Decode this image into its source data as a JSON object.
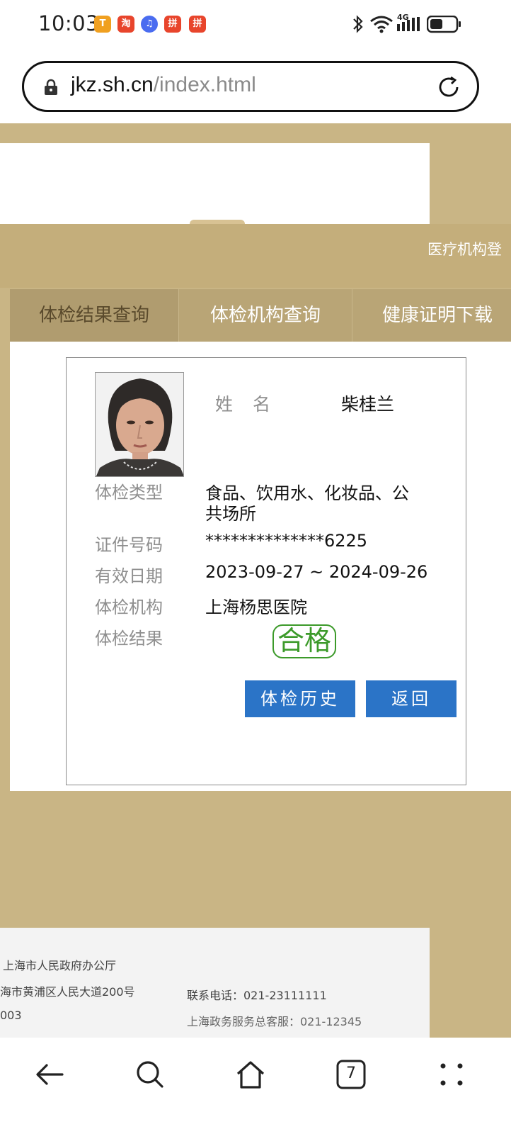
{
  "status_bar": {
    "time": "10:03",
    "apps": [
      {
        "icon": "message-app-icon",
        "color": "#f0a020",
        "glyph": "T"
      },
      {
        "icon": "taobao-app-icon",
        "color": "#e8452c",
        "glyph": "淘"
      },
      {
        "icon": "music-app-icon",
        "color": "#4a6cf0",
        "glyph": "♫"
      },
      {
        "icon": "pinduoduo-app-icon",
        "color": "#e8452c",
        "glyph": "拼"
      },
      {
        "icon": "pinduoduo-app-icon",
        "color": "#e8452c",
        "glyph": "拼"
      }
    ],
    "signal_label": "4G"
  },
  "browser": {
    "url_host": "jkz.sh.cn",
    "url_path": "/index.html"
  },
  "header": {
    "org_register": "医疗机构登"
  },
  "nav": {
    "items": [
      {
        "label": "体检结果查询"
      },
      {
        "label": "体检机构查询"
      },
      {
        "label": "健康证明下载"
      }
    ]
  },
  "record": {
    "name_label": "姓名",
    "name": "柴桂兰",
    "type_label": "体检类型",
    "type_line1": "食品、饮用水、化妆品、公",
    "type_line2": "共场所",
    "id_label": "证件号码",
    "id_value": "**************6225",
    "valid_label": "有效日期",
    "valid_value": "2023-09-27 ~ 2024-09-26",
    "org_label": "体检机构",
    "org_value": "上海杨思医院",
    "result_label": "体检结果",
    "result_value": "合格",
    "history_button": "体检历史",
    "back_button": "返回"
  },
  "footer": {
    "sponsor": "上海市人民政府办公厅",
    "address": "海市黄浦区人民大道200号",
    "postcode": "003",
    "phone": "联系电话：021-23111111",
    "hotline": "上海政务服务总客服：021-12345"
  },
  "bottom_nav": {
    "tab_count": "7"
  },
  "colors": {
    "gold": "#c9b585",
    "button_blue": "#2b74c7",
    "pass_green": "#3c9a2a"
  }
}
